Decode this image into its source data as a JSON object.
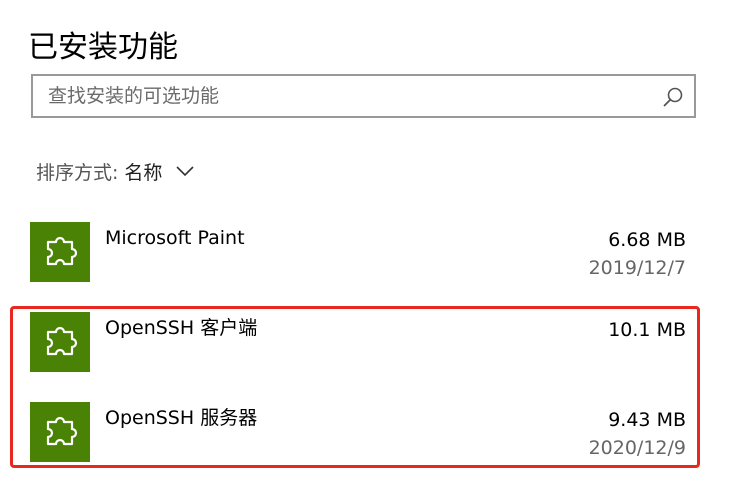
{
  "page": {
    "title": "已安装功能"
  },
  "search": {
    "placeholder": "查找安装的可选功能",
    "value": "",
    "icon": "search-icon"
  },
  "sort": {
    "label": "排序方式:",
    "value": "名称",
    "icon": "chevron-down-icon"
  },
  "features": [
    {
      "name": "Microsoft Paint",
      "size": "6.68 MB",
      "date": "2019/12/7",
      "icon": "puzzle-piece-icon"
    },
    {
      "name": "OpenSSH 客户端",
      "size": "10.1 MB",
      "date": "",
      "icon": "puzzle-piece-icon"
    },
    {
      "name": "OpenSSH 服务器",
      "size": "9.43 MB",
      "date": "2020/12/9",
      "icon": "puzzle-piece-icon"
    }
  ],
  "colors": {
    "tile": "#498205",
    "highlight": "#e8281e",
    "search_border": "#999999"
  }
}
